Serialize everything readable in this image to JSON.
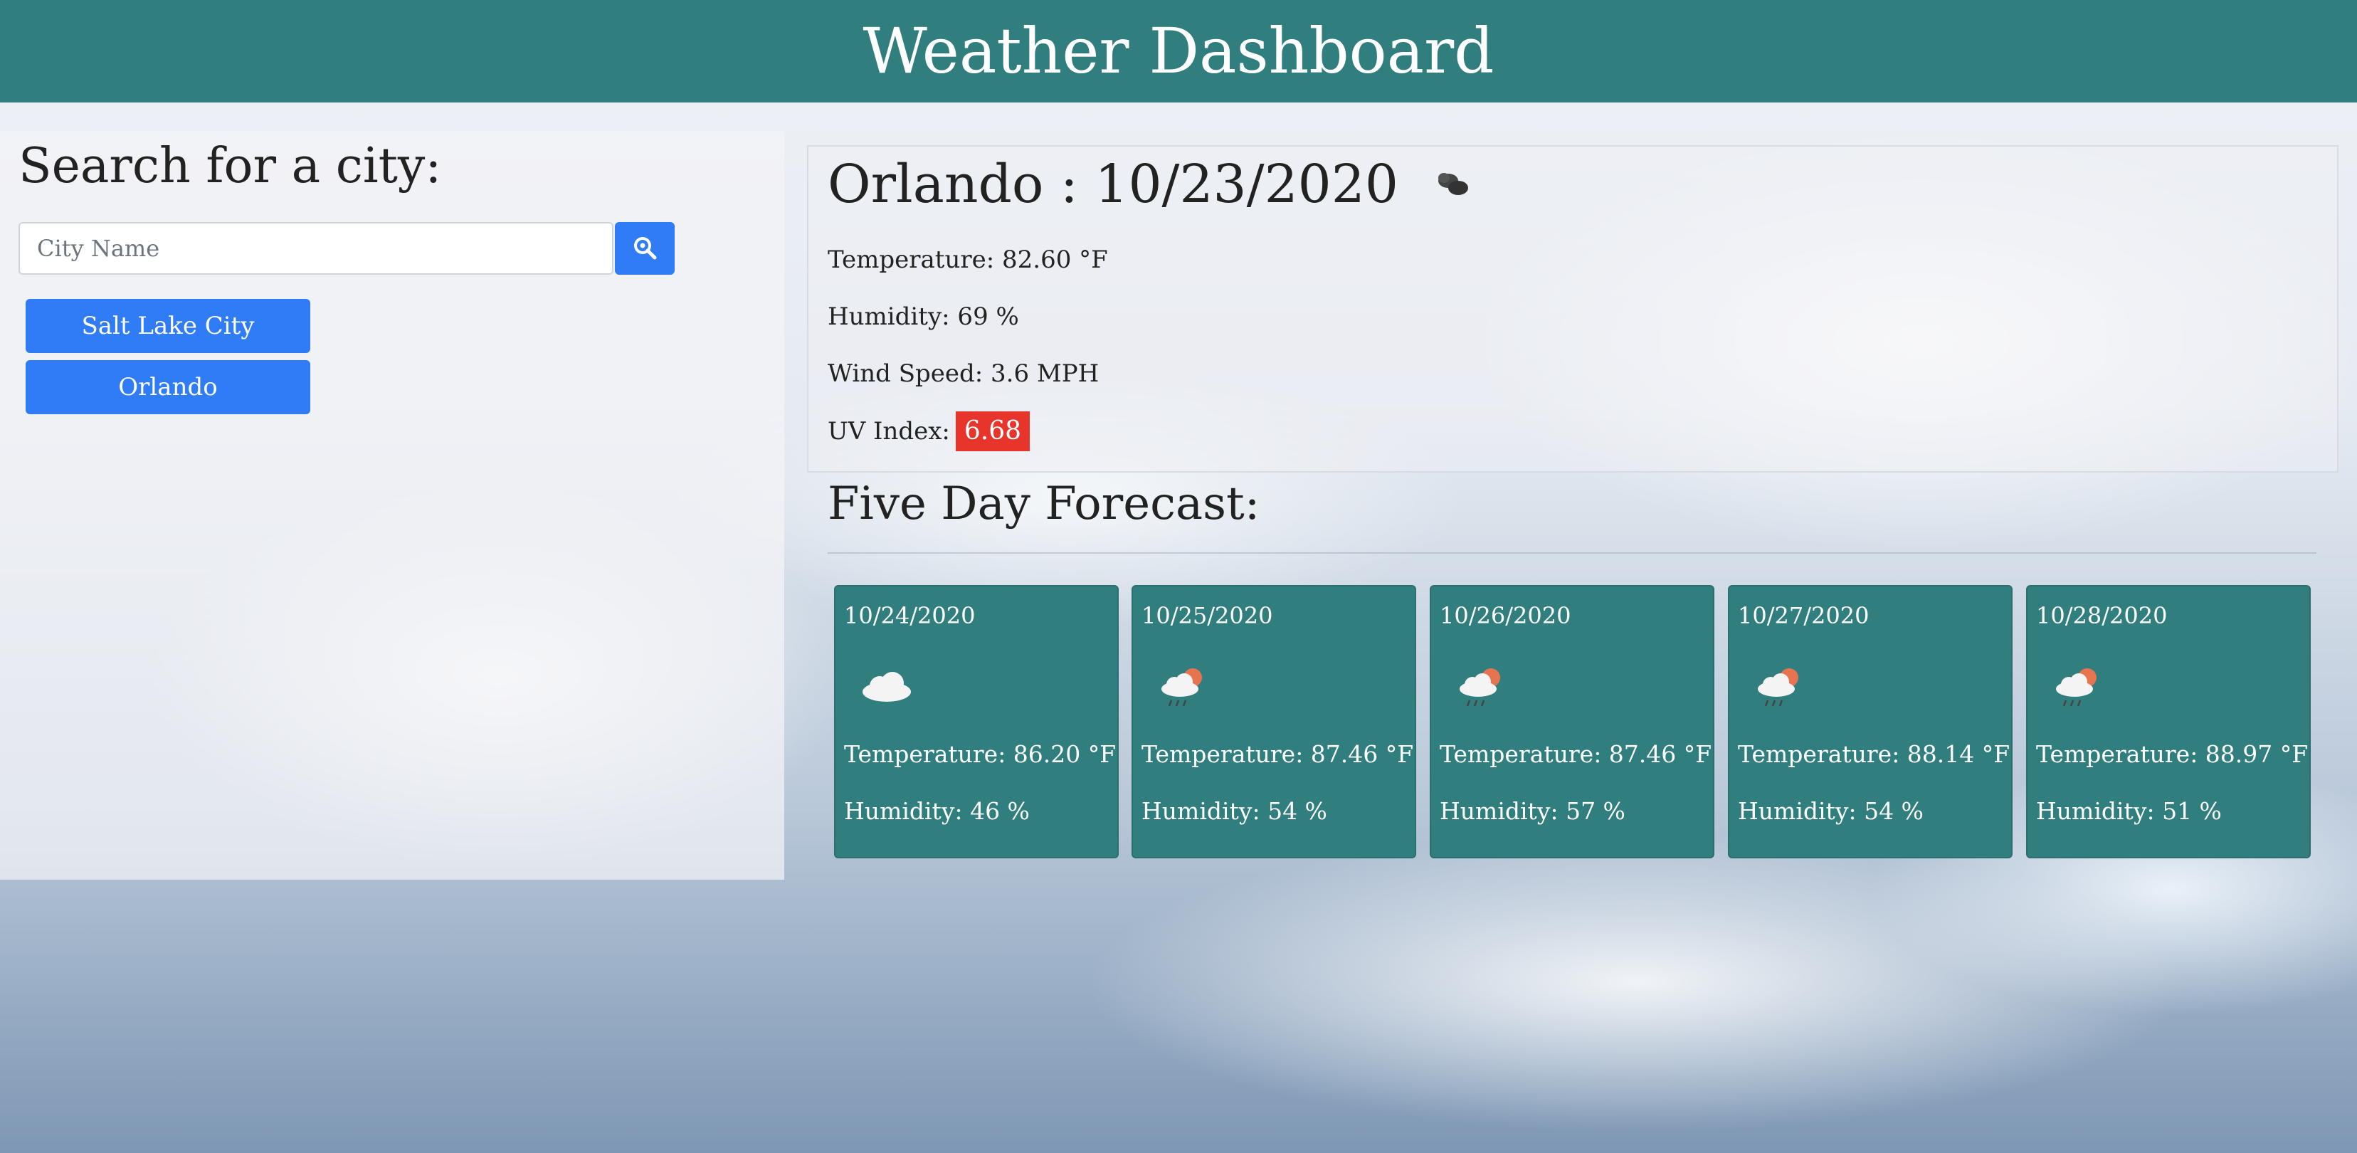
{
  "header": {
    "title": "Weather Dashboard"
  },
  "sidebar": {
    "search_title": "Search for a city:",
    "search_placeholder": "City Name",
    "history": [
      "Salt Lake City",
      "Orlando"
    ]
  },
  "current": {
    "title": "Orlando : 10/23/2020",
    "icon": "clouds-icon",
    "temperature": "Temperature: 82.60 °F",
    "humidity": "Humidity: 69 %",
    "wind": "Wind Speed: 3.6 MPH",
    "uv_label": "UV Index:",
    "uv_value": "6.68",
    "uv_color": "#e8352b"
  },
  "forecast": {
    "title": "Five Day Forecast:",
    "days": [
      {
        "date": "10/24/2020",
        "icon": "cloud-icon",
        "temp": "Temperature: 86.20 °F",
        "humidity": "Humidity: 46 %"
      },
      {
        "date": "10/25/2020",
        "icon": "sun-rain-cloud-icon",
        "temp": "Temperature: 87.46 °F",
        "humidity": "Humidity: 54 %"
      },
      {
        "date": "10/26/2020",
        "icon": "sun-rain-cloud-icon",
        "temp": "Temperature: 87.46 °F",
        "humidity": "Humidity: 57 %"
      },
      {
        "date": "10/27/2020",
        "icon": "sun-rain-cloud-icon",
        "temp": "Temperature: 88.14 °F",
        "humidity": "Humidity: 54 %"
      },
      {
        "date": "10/28/2020",
        "icon": "sun-rain-cloud-icon",
        "temp": "Temperature: 88.97 °F",
        "humidity": "Humidity: 51 %"
      }
    ]
  },
  "colors": {
    "header": "#317e7e",
    "primary_button": "#2f7cf6",
    "card": "#317e7e"
  }
}
